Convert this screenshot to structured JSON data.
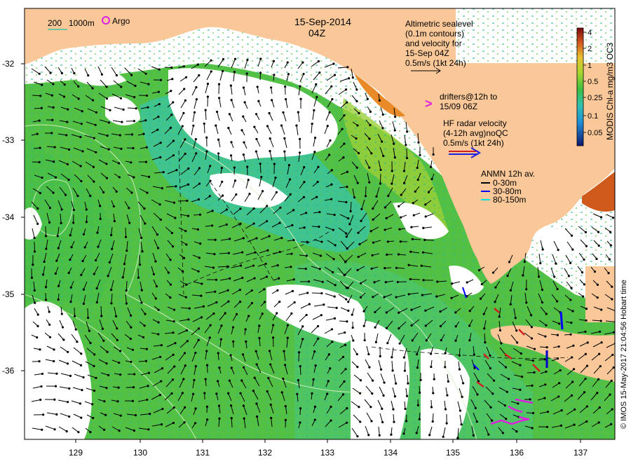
{
  "header": {
    "date": "15-Sep-2014",
    "time": "04Z",
    "contour_legend_a": "200",
    "contour_legend_b": "1000m",
    "argo_label": "Argo"
  },
  "legend": {
    "altimetry": [
      "Altimetric sealevel",
      "(0.1m contours)",
      "and velocity for",
      "15-Sep 04Z",
      "0.5m/s (1kt 24h)"
    ],
    "drifters": [
      "drifters@12h to",
      "15/09 06Z"
    ],
    "drifter_symbol": ">",
    "hf_radar": [
      "HF radar velocity",
      "(4-12h avg)noQC",
      "0.5m/s (1kt 24h)"
    ],
    "anmn": {
      "title": "ANMN 12h av.",
      "items": [
        {
          "label": "0-30m",
          "color": "#000000"
        },
        {
          "label": "30-80m",
          "color": "#0000ff"
        },
        {
          "label": "80-150m",
          "color": "#00e0e0"
        }
      ]
    }
  },
  "colorbar": {
    "title": "MODIS Chl-a mg/m3 OC3",
    "ticks": [
      "4",
      "2",
      "1",
      "0.5",
      "0.25",
      "0.1",
      "0.05"
    ]
  },
  "axes": {
    "x_ticks": [
      "129",
      "130",
      "131",
      "132",
      "133",
      "134",
      "135",
      "136",
      "137"
    ],
    "y_ticks": [
      "-32",
      "-33",
      "-34",
      "-35",
      "-36"
    ]
  },
  "credit": "© IMOS 15-May-2017 21:04:56 Hobart time",
  "colors": {
    "land": "#fac898",
    "ocean_green": "#4cbf44",
    "ocean_teal": "#3cc4a0",
    "cloud": "#ffffff"
  }
}
